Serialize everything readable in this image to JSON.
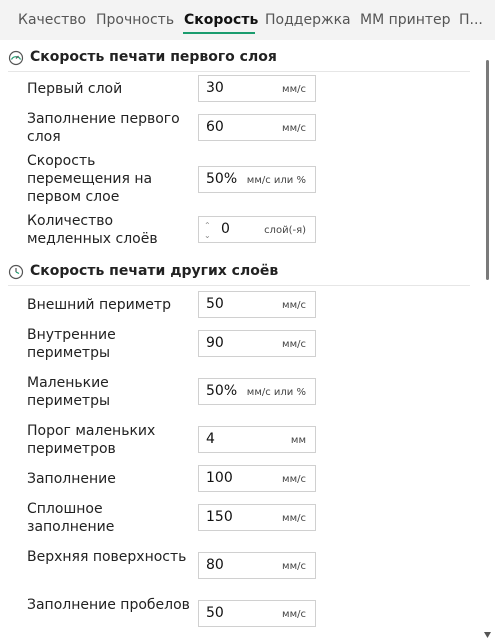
{
  "tabs": [
    {
      "label": "Качество",
      "active": false
    },
    {
      "label": "Прочность",
      "active": false
    },
    {
      "label": "Скорость",
      "active": true
    },
    {
      "label": "Поддержка",
      "active": false
    },
    {
      "label": "MM принтер",
      "active": false
    },
    {
      "label": "П...",
      "active": false
    }
  ],
  "accent_color": "#1a9c6e",
  "sections": [
    {
      "title": "Скорость печати первого слоя",
      "icon": "speedometer-icon",
      "rows": [
        {
          "label": "Первый слой",
          "value": "30",
          "unit": "мм/с"
        },
        {
          "label": "Заполнение первого слоя",
          "value": "60",
          "unit": "мм/с"
        },
        {
          "label": "Скорость перемещения на первом слое",
          "value": "50%",
          "unit": "мм/с или %"
        },
        {
          "label": "Количество медленных слоёв",
          "value": "0",
          "unit": "слой(-я)"
        }
      ]
    },
    {
      "title": "Скорость печати других слоёв",
      "icon": "speed-clock-icon",
      "rows": [
        {
          "label": "Внешний периметр",
          "value": "50",
          "unit": "мм/с"
        },
        {
          "label": "Внутренние периметры",
          "value": "90",
          "unit": "мм/с"
        },
        {
          "label": "Маленькие периметры",
          "value": "50%",
          "unit": "мм/с или %"
        },
        {
          "label": "Порог маленьких периметров",
          "value": "4",
          "unit": "мм"
        },
        {
          "label": "Заполнение",
          "value": "100",
          "unit": "мм/с"
        },
        {
          "label": "Сплошное заполнение",
          "value": "150",
          "unit": "мм/с"
        },
        {
          "label": "Верхняя поверхность",
          "value": "80",
          "unit": "мм/с"
        },
        {
          "label": "Заполнение пробелов",
          "value": "50",
          "unit": "мм/с"
        }
      ]
    }
  ]
}
